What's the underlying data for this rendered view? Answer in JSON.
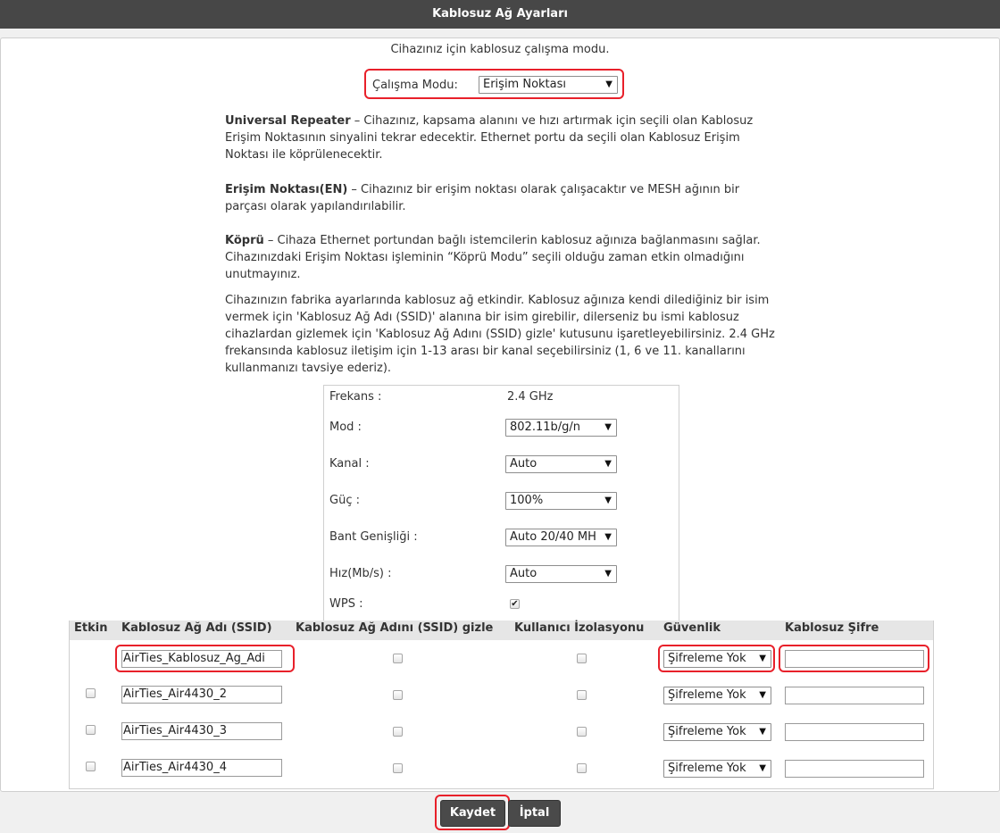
{
  "header": {
    "title": "Kablosuz Ağ Ayarları"
  },
  "intro": "Cihazınız için kablosuz çalışma modu.",
  "mode": {
    "label": "Çalışma Modu:",
    "value": "Erişim Noktası"
  },
  "descriptions": {
    "repeater_title": "Universal Repeater",
    "repeater_text": " – Cihazınız, kapsama alanını ve hızı artırmak için seçili olan Kablosuz Erişim Noktasının sinyalini tekrar edecektir. Ethernet portu da seçili olan Kablosuz Erişim Noktası ile köprülenecektir.",
    "ap_title": "Erişim Noktası(EN)",
    "ap_text": " – Cihazınız bir erişim noktası olarak çalışacaktır ve MESH ağının bir parçası olarak yapılandırılabilir.",
    "bridge_title": "Köprü",
    "bridge_text": " – Cihaza Ethernet portundan bağlı istemcilerin kablosuz ağınıza bağlanmasını sağlar. Cihazınızdaki Erişim Noktası işleminin “Köprü Modu” seçili olduğu zaman etkin olmadığını unutmayınız.",
    "factory_text": "Cihazınızın fabrika ayarlarında kablosuz ağ etkindir. Kablosuz ağınıza kendi dilediğiniz bir isim vermek için 'Kablosuz Ağ Adı (SSID)' alanına bir isim girebilir, dilerseniz bu ismi kablosuz cihazlardan gizlemek için 'Kablosuz Ağ Adını (SSID) gizle' kutusunu işaretleyebilirsiniz. 2.4 GHz frekansında kablosuz iletişim için 1-13 arası bir kanal seçebilirsiniz (1, 6 ve 11. kanallarını kullanmanızı tavsiye ederiz)."
  },
  "settings": {
    "frequency": {
      "label": "Frekans :",
      "value": "2.4 GHz"
    },
    "mode": {
      "label": "Mod :",
      "value": "802.11b/g/n"
    },
    "channel": {
      "label": "Kanal :",
      "value": "Auto"
    },
    "power": {
      "label": "Güç :",
      "value": "100%"
    },
    "bandwidth": {
      "label": "Bant Genişliği :",
      "value": "Auto 20/40 MH"
    },
    "rate": {
      "label": "Hız(Mb/s) :",
      "value": "Auto"
    },
    "wps": {
      "label": "WPS :",
      "checked": true
    }
  },
  "table": {
    "headers": [
      "Etkin",
      "Kablosuz Ağ Adı (SSID)",
      "Kablosuz Ağ Adını (SSID) gizle",
      "Kullanıcı İzolasyonu",
      "Güvenlik",
      "Kablosuz Şifre"
    ],
    "rows": [
      {
        "ssid": "AirTies_Kablosuz_Ag_Adi",
        "security": "Şifreleme Yok",
        "password": ""
      },
      {
        "ssid": "AirTies_Air4430_2",
        "security": "Şifreleme Yok",
        "password": ""
      },
      {
        "ssid": "AirTies_Air4430_3",
        "security": "Şifreleme Yok",
        "password": ""
      },
      {
        "ssid": "AirTies_Air4430_4",
        "security": "Şifreleme Yok",
        "password": ""
      }
    ]
  },
  "buttons": {
    "save": "Kaydet",
    "cancel": "İptal"
  },
  "colors": {
    "highlight": "#e8202a",
    "header_bg": "#474747",
    "button_bg": "#4a4a4a"
  }
}
